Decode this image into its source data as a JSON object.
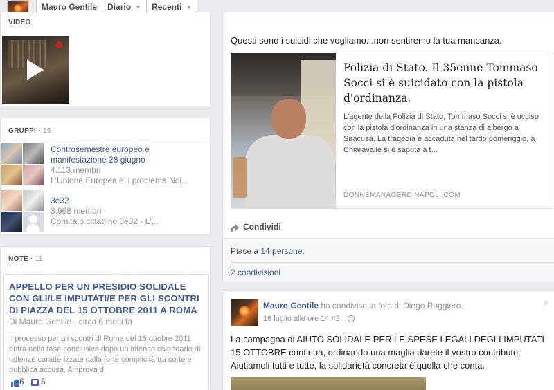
{
  "header": {
    "crumbs": [
      "Mauro Gentile",
      "Diario",
      "Recenti"
    ]
  },
  "video_section": {
    "label": "VIDEO"
  },
  "groups": {
    "label": "GRUPPI",
    "count": "16",
    "items": [
      {
        "title_line1": "Controsemestre europeo e",
        "title_line2": "manifestazione 28 giugno",
        "members": "4.113 membri",
        "desc": "L'Unione Europea è il problema Noi..."
      },
      {
        "title_line1": "3e32",
        "title_line2": "",
        "members": "3.968 membri",
        "desc": "Comitato cittadino 3e32 - L'..."
      }
    ]
  },
  "notes": {
    "label": "NOTE",
    "count": "11",
    "note": {
      "title": "APPELLO PER UN PRESIDIO SOLIDALE CON GLI/LE IMPUTATI/E PER GLI SCONTRI DI PIAZZA DEL 15 OTTOBRE 2011 A ROMA",
      "byline": "Di Mauro Gentile · circa 6 mesi fa",
      "excerpt": "Il processo per gli scontri di Roma del 15 ottobre 2011 entra nella fase conclusiva dopo un intenso calendario di udienze caratterizzate dalla forte complicità tra corte e pubblica accusa. A riprova d",
      "likes": "6",
      "comments": "5"
    }
  },
  "post1": {
    "text": "Questi sono i suicidi che vogliamo...non sentiremo la tua mancanza.",
    "link": {
      "title": "Polizia di Stato. Il 35enne Tommaso Socci si è suicidato con la pistola d'ordinanza.",
      "description": "L'agente della Polizia di Stato, Tommaso Socci si è ucciso con la pistola d'ordinanza in una stanza di albergo a Siracusa. La tragedia è accaduta nel tardo pomeriggio, a Chiaravalle si è saputa a t...",
      "domain": "DONNEMANAGERDINAPOLI.COM"
    },
    "share_label": "Condividi",
    "likes_prefix": "Piace a ",
    "likes_link": "14 persone",
    "likes_suffix": ".",
    "shares": "2 condivisioni"
  },
  "post2": {
    "author": "Mauro Gentile",
    "action": " ha condiviso la foto di Diego Ruggiero.",
    "timestamp": "16 luglio alle ore 14.42 ·",
    "text": "La campagna di AIUTO SOLIDALE PER LE SPESE LEGALI DEGLI IMPUTATI 15 OTTOBRE continua, ordinando una maglia darete il vostro contributo. Aiutiamoli tutti e tutte, la solidarietà concreta è quella che conta."
  }
}
